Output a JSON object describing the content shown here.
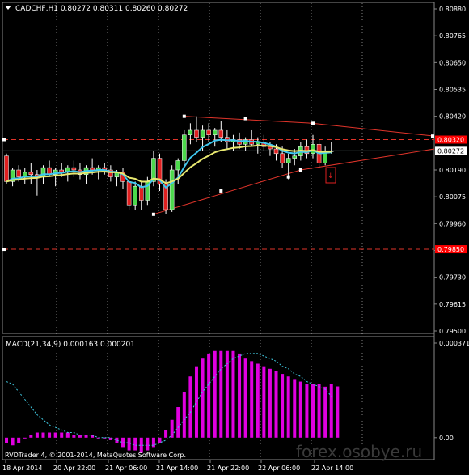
{
  "header": {
    "symbol_info": "CADCHF,H1  0.80272 0.80311 0.80260 0.80272"
  },
  "price_axis": {
    "ticks": [
      "0.80880",
      "0.80765",
      "0.80650",
      "0.80535",
      "0.80420",
      "0.80190",
      "0.80075",
      "0.79960",
      "0.79845",
      "0.79730",
      "0.79615",
      "0.79500"
    ],
    "tick_values": [
      0.8088,
      0.80765,
      0.8065,
      0.80535,
      0.8042,
      0.8019,
      0.80075,
      0.7996,
      0.79845,
      0.7973,
      0.79615,
      0.795
    ],
    "ylim": [
      0.795,
      0.8088
    ],
    "line_labels": [
      {
        "text": "0.80320",
        "value": 0.8032,
        "color": "#ff0000"
      },
      {
        "text": "0.80272",
        "value": 0.80272,
        "color": "#ffffff"
      },
      {
        "text": "0.79850",
        "value": 0.7985,
        "color": "#ff0000"
      }
    ]
  },
  "horizontal_levels": [
    {
      "value": 0.8032,
      "color": "#e0342a",
      "style": "dashed"
    },
    {
      "value": 0.7985,
      "color": "#e0342a",
      "style": "dashed"
    }
  ],
  "indicator": {
    "label": "MACD(21,34,9) 0.000163 0.000201",
    "ticks": [
      "0.000371",
      "0.00"
    ],
    "ylim": [
      -8e-05,
      0.000371
    ],
    "histogram_color": "#e000e0",
    "signal_color": "#40c8e0"
  },
  "time_axis": {
    "labels": [
      "18 Apr 2014",
      "20 Apr 22:00",
      "21 Apr 06:00",
      "21 Apr 14:00",
      "21 Apr 22:00",
      "22 Apr 06:00",
      "22 Apr 14:00"
    ]
  },
  "watermark": "forex.osobye.ru",
  "copyright": "RVDTrader 4, © 2001-2014, MetaQuotes Software Corp.",
  "colors": {
    "bull": "#4cd94c",
    "bear": "#e02020",
    "fast_ma": "#40c8f0",
    "slow_ma": "#e8e870",
    "trendline": "#e0342a",
    "grid": "#ffffff"
  },
  "chart_data": [
    {
      "type": "candlestick",
      "symbol": "CADCHF",
      "timeframe": "H1",
      "ylim": [
        0.795,
        0.8088
      ],
      "candles": [
        [
          0.8025,
          0.8026,
          0.8013,
          0.8014
        ],
        [
          0.8014,
          0.802,
          0.8012,
          0.8019
        ],
        [
          0.8019,
          0.8021,
          0.8014,
          0.8016
        ],
        [
          0.8016,
          0.802,
          0.8013,
          0.8018
        ],
        [
          0.8018,
          0.8022,
          0.8013,
          0.8017
        ],
        [
          0.8017,
          0.8019,
          0.8008,
          0.8016
        ],
        [
          0.8016,
          0.8021,
          0.8013,
          0.802
        ],
        [
          0.802,
          0.8023,
          0.8016,
          0.8017
        ],
        [
          0.8017,
          0.802,
          0.8012,
          0.8019
        ],
        [
          0.8019,
          0.8022,
          0.8016,
          0.8018
        ],
        [
          0.8018,
          0.8021,
          0.8014,
          0.802
        ],
        [
          0.802,
          0.8023,
          0.8016,
          0.8019
        ],
        [
          0.8019,
          0.8022,
          0.8015,
          0.8017
        ],
        [
          0.8017,
          0.8021,
          0.8013,
          0.802
        ],
        [
          0.802,
          0.8024,
          0.8017,
          0.8019
        ],
        [
          0.8019,
          0.8021,
          0.8015,
          0.802
        ],
        [
          0.802,
          0.8022,
          0.8017,
          0.8019
        ],
        [
          0.8019,
          0.8021,
          0.8014,
          0.8016
        ],
        [
          0.8016,
          0.8019,
          0.8012,
          0.8018
        ],
        [
          0.8018,
          0.802,
          0.8011,
          0.8014
        ],
        [
          0.8014,
          0.8016,
          0.8002,
          0.8004
        ],
        [
          0.8004,
          0.8014,
          0.8002,
          0.8012
        ],
        [
          0.8012,
          0.8014,
          0.8002,
          0.8006
        ],
        [
          0.8006,
          0.8016,
          0.8004,
          0.8014
        ],
        [
          0.8014,
          0.8027,
          0.8012,
          0.8024
        ],
        [
          0.8024,
          0.8026,
          0.801,
          0.8013
        ],
        [
          0.8013,
          0.8015,
          0.8,
          0.8002
        ],
        [
          0.8002,
          0.8021,
          0.8001,
          0.8019
        ],
        [
          0.8019,
          0.8024,
          0.8013,
          0.8023
        ],
        [
          0.8023,
          0.8036,
          0.8021,
          0.8034
        ],
        [
          0.8034,
          0.8039,
          0.803,
          0.8036
        ],
        [
          0.8036,
          0.8042,
          0.8031,
          0.8033
        ],
        [
          0.8033,
          0.8038,
          0.8027,
          0.8036
        ],
        [
          0.8036,
          0.8039,
          0.8031,
          0.8034
        ],
        [
          0.8034,
          0.8037,
          0.8029,
          0.8036
        ],
        [
          0.8036,
          0.804,
          0.8031,
          0.8033
        ],
        [
          0.8033,
          0.8036,
          0.8028,
          0.8031
        ],
        [
          0.8031,
          0.8034,
          0.8027,
          0.8032
        ],
        [
          0.8032,
          0.8035,
          0.8028,
          0.803
        ],
        [
          0.803,
          0.8033,
          0.8027,
          0.8032
        ],
        [
          0.8032,
          0.8036,
          0.8029,
          0.803
        ],
        [
          0.803,
          0.8033,
          0.8026,
          0.8031
        ],
        [
          0.8031,
          0.8034,
          0.8027,
          0.8029
        ],
        [
          0.8029,
          0.8031,
          0.8025,
          0.8028
        ],
        [
          0.8028,
          0.803,
          0.8023,
          0.8026
        ],
        [
          0.8026,
          0.8029,
          0.802,
          0.8022
        ],
        [
          0.8022,
          0.8026,
          0.8015,
          0.8024
        ],
        [
          0.8024,
          0.8028,
          0.8021,
          0.8025
        ],
        [
          0.8025,
          0.8031,
          0.8023,
          0.8029
        ],
        [
          0.8029,
          0.8032,
          0.8024,
          0.8026
        ],
        [
          0.8026,
          0.8034,
          0.8024,
          0.803
        ],
        [
          0.803,
          0.8032,
          0.802,
          0.8022
        ],
        [
          0.8022,
          0.8029,
          0.8021,
          0.8027
        ],
        [
          0.8027,
          0.80311,
          0.8026,
          0.80272
        ]
      ]
    },
    {
      "type": "line",
      "name": "MACD(21,34,9)",
      "histogram": [
        -2e-05,
        -3e-05,
        -2e-05,
        0.0,
        1e-05,
        2e-05,
        2e-05,
        2e-05,
        2e-05,
        2e-05,
        2e-05,
        1e-05,
        1e-05,
        1e-05,
        1e-05,
        0.0,
        0.0,
        -1e-05,
        -2e-05,
        -4e-05,
        -5e-05,
        -5e-05,
        -6e-05,
        -5e-05,
        -4e-05,
        -2e-05,
        3e-05,
        7e-05,
        0.00012,
        0.00018,
        0.00024,
        0.00028,
        0.00031,
        0.00033,
        0.00034,
        0.00034,
        0.00034,
        0.00034,
        0.00033,
        0.00031,
        0.0003,
        0.00029,
        0.00028,
        0.00027,
        0.00026,
        0.00025,
        0.00024,
        0.00023,
        0.00022,
        0.00021,
        0.00021,
        0.00021,
        0.0002,
        0.00021,
        0.000201
      ],
      "signal": [
        0.00022,
        0.00021,
        0.00018,
        0.00015,
        0.00012,
        9e-05,
        7e-05,
        5e-05,
        4e-05,
        3e-05,
        2e-05,
        2e-05,
        1e-05,
        1e-05,
        1e-05,
        0.0,
        0.0,
        0.0,
        -1e-05,
        -2e-05,
        -2e-05,
        -3e-05,
        -3e-05,
        -3e-05,
        -3e-05,
        -2e-05,
        -1e-05,
        1e-05,
        4e-05,
        7e-05,
        0.0001,
        0.00014,
        0.00018,
        0.00021,
        0.00024,
        0.00027,
        0.00029,
        0.00031,
        0.00032,
        0.00033,
        0.00033,
        0.00033,
        0.00032,
        0.00031,
        0.0003,
        0.00028,
        0.00027,
        0.00025,
        0.00024,
        0.00022,
        0.00021,
        0.0002,
        0.00019,
        0.000163
      ]
    }
  ]
}
